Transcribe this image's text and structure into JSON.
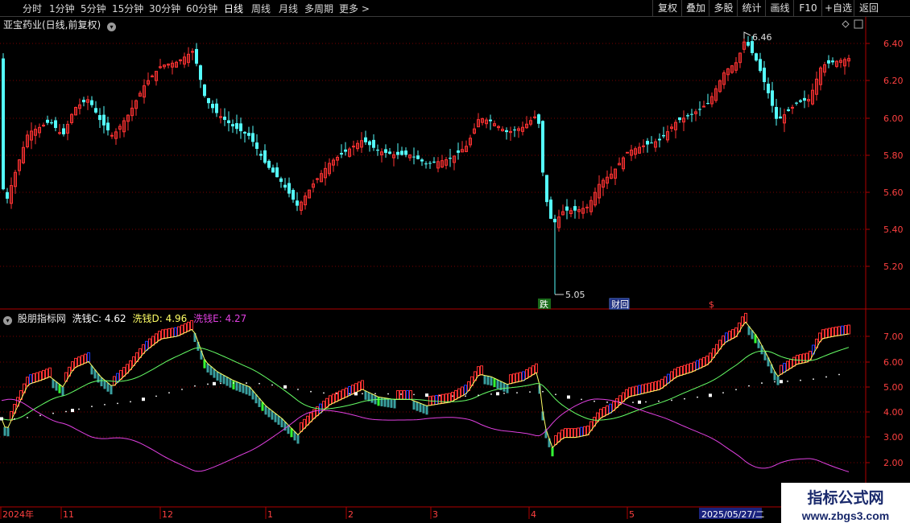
{
  "toolbar": {
    "periods": [
      "分时",
      "1分钟",
      "5分钟",
      "15分钟",
      "30分钟",
      "60分钟",
      "日线",
      "周线",
      "月线",
      "多周期",
      "更多 >"
    ],
    "active_period": "日线",
    "right_buttons": [
      "复权",
      "叠加",
      "多股",
      "统计",
      "画线",
      "F10",
      "+自选",
      "返回"
    ]
  },
  "main_panel": {
    "title": "亚宝药业(日线,前复权)",
    "y_ticks": [
      "6.40",
      "6.20",
      "6.00",
      "5.80",
      "5.60",
      "5.40",
      "5.20"
    ],
    "high_label": "6.46",
    "low_label": "5.05",
    "markers": [
      "跌",
      "财回",
      "$"
    ]
  },
  "indicator_panel": {
    "name": "股朋指标网",
    "c_label": "洗钱C: 4.62",
    "d_label": "洗钱D: 4.96",
    "e_label": "洗钱E: 4.27",
    "y_ticks": [
      "7.00",
      "6.00",
      "5.00",
      "4.00",
      "3.00",
      "2.00"
    ],
    "colors": {
      "c": "#e6e6e6",
      "d": "#ffff66",
      "e": "#e040e0"
    }
  },
  "x_axis": {
    "labels": [
      "2024年",
      "11",
      "12",
      "1",
      "2",
      "3",
      "4",
      "5"
    ],
    "date_badge": "2025/05/27/二"
  },
  "watermark": {
    "line1": "指标公式网",
    "line2": "www.zbgs3.com"
  },
  "colors": {
    "up": "#ff3232",
    "down": "#54fcfc",
    "grid": "#7a0000",
    "axis": "#b00000"
  }
}
